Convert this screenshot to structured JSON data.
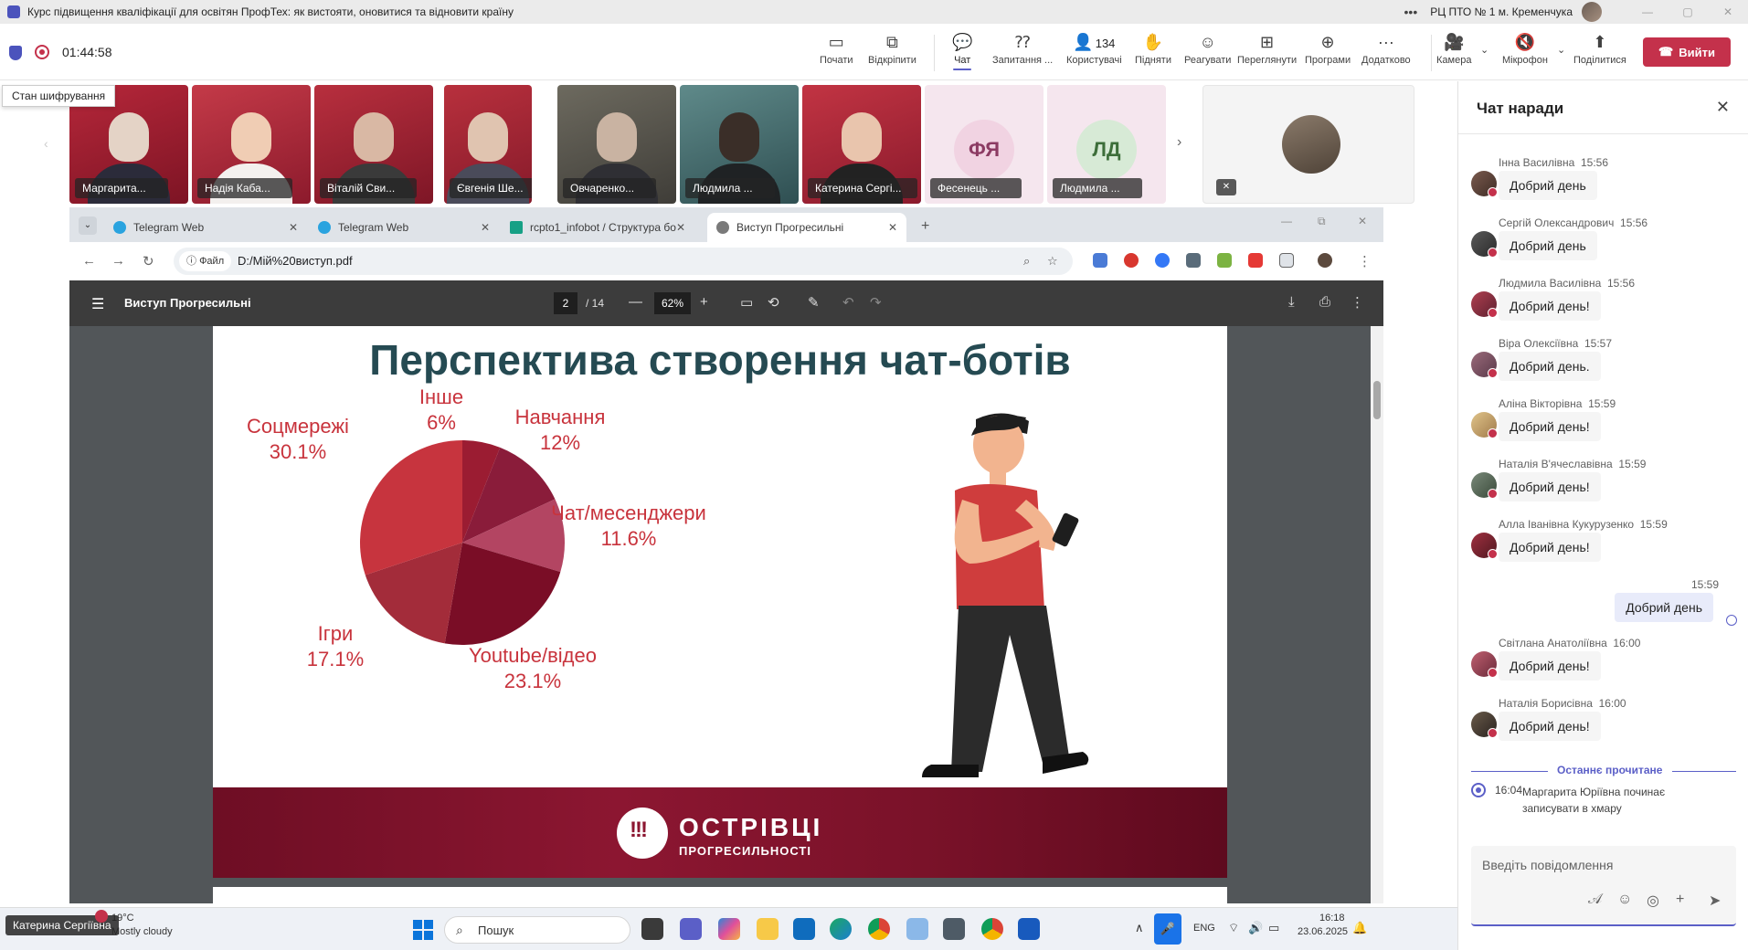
{
  "window": {
    "title": "Курс підвищення кваліфікації для освітян ПрофТех: як вистояти, оновитися та відновити країну",
    "org": "РЦ ПТО № 1 м. Кременчука"
  },
  "meeting": {
    "timer": "01:44:58",
    "tooltip": "Стан шифрування",
    "tools": {
      "start": "Почати",
      "unpin": "Відкріпити",
      "chat": "Чат",
      "qa": "Запитання ...",
      "people": "Користувачі",
      "people_count": "134",
      "raise": "Підняти",
      "react": "Реагувати",
      "view": "Переглянути",
      "apps": "Програми",
      "more": "Додатково",
      "camera": "Камера",
      "mic": "Мікрофон",
      "share": "Поділитися",
      "leave": "Вийти"
    }
  },
  "participants": [
    {
      "name": "Маргарита..."
    },
    {
      "name": "Надія Каба..."
    },
    {
      "name": "Віталій Сви..."
    },
    {
      "name": "Євгенія Ше..."
    },
    {
      "name": "Овчаренко..."
    },
    {
      "name": "Людмила ..."
    },
    {
      "name": "Катерина Сергі..."
    },
    {
      "name": "Фесенець ...",
      "initials": "ФЯ"
    },
    {
      "name": "Людмила ...",
      "initials": "ЛД"
    }
  ],
  "browser": {
    "tabs": [
      "Telegram Web",
      "Telegram Web",
      "rcpto1_infobot / Структура бо",
      "Виступ Прогресильні"
    ],
    "url_info": "Файл",
    "url": "D:/Мій%20виступ.pdf"
  },
  "pdf": {
    "title": "Виступ Прогресильні",
    "page": "2",
    "total": "/ 14",
    "zoom": "62%"
  },
  "slide": {
    "title": "Перспектива створення чат-ботів",
    "brand_line1": "ОСТРІВЦІ",
    "brand_line2": "ПРОГРЕСИЛЬНОСТІ"
  },
  "chart_data": {
    "type": "pie",
    "categories": [
      "Інше",
      "Навчання",
      "Чат/месенджери",
      "Youtube/відео",
      "Ігри",
      "Соцмережі"
    ],
    "values": [
      6,
      12,
      11.6,
      23.1,
      17.1,
      30.1
    ],
    "value_labels": [
      "6%",
      "12%",
      "11.6%",
      "23.1%",
      "17.1%",
      "30.1%"
    ],
    "colors": [
      "#9b1c32",
      "#8a1c3a",
      "#b34562",
      "#7a0d26",
      "#a32c3a",
      "#c7343e"
    ],
    "label_color": "#c8333c"
  },
  "taskbar": {
    "presenter": "Катерина Сергіївна",
    "temp": "19°C",
    "weather": "Mostly cloudy",
    "search": "Пошук",
    "lang": "ENG",
    "time": "16:18",
    "date": "23.06.2025"
  },
  "chat": {
    "title": "Чат наради",
    "messages": [
      {
        "author": "Інна Василівна",
        "time": "15:56",
        "text": "Добрий день"
      },
      {
        "author": "Сергій Олександрович",
        "time": "15:56",
        "text": "Добрий день"
      },
      {
        "author": "Людмила Василівна",
        "time": "15:56",
        "text": "Добрий день!"
      },
      {
        "author": "Віра Олексіївна",
        "time": "15:57",
        "text": "Добрий день."
      },
      {
        "author": "Аліна Вікторівна",
        "time": "15:59",
        "text": "Добрий день!"
      },
      {
        "author": "Наталія В'ячеславівна",
        "time": "15:59",
        "text": "Добрий день!"
      },
      {
        "author": "Алла Іванівна Кукурузенко",
        "time": "15:59",
        "text": "Добрий день!"
      }
    ],
    "mine": {
      "time": "15:59",
      "text": "Добрий день"
    },
    "messages2": [
      {
        "author": "Світлана Анатоліївна",
        "time": "16:00",
        "text": "Добрий день!"
      },
      {
        "author": "Наталія Борисівна",
        "time": "16:00",
        "text": "Добрий день!"
      }
    ],
    "last_read": "Останнє прочитане",
    "system": {
      "time": "16:04",
      "text": "Маргарита Юріївна починає записувати в хмару"
    },
    "compose_placeholder": "Введіть повідомлення"
  }
}
